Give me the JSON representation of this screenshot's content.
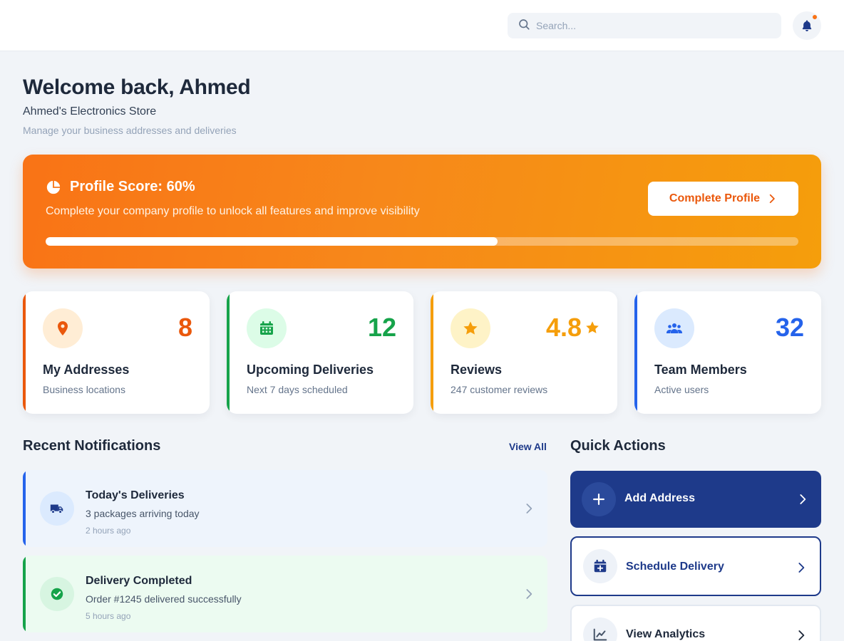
{
  "search": {
    "placeholder": "Search..."
  },
  "header": {
    "title": "Welcome back, Ahmed",
    "store_name": "Ahmed's Electronics Store",
    "subtitle": "Manage your business addresses and deliveries"
  },
  "profile_banner": {
    "title": "Profile Score: 60%",
    "description": "Complete your company profile to unlock all features and improve visibility",
    "progress_percent": 60,
    "button_label": "Complete Profile"
  },
  "stats": [
    {
      "label": "My Addresses",
      "value": "8",
      "sub": "Business locations",
      "color": "#ea580c",
      "icon": "map-pin-icon"
    },
    {
      "label": "Upcoming Deliveries",
      "value": "12",
      "sub": "Next 7 days scheduled",
      "color": "#16a34a",
      "icon": "calendar-icon"
    },
    {
      "label": "Reviews",
      "value": "4.8",
      "sub": "247 customer reviews",
      "color": "#f59e0b",
      "icon": "star-icon"
    },
    {
      "label": "Team Members",
      "value": "32",
      "sub": "Active users",
      "color": "#2563eb",
      "icon": "users-icon"
    }
  ],
  "notifications": {
    "title": "Recent Notifications",
    "view_all": "View All",
    "items": [
      {
        "title": "Today's Deliveries",
        "description": "3 packages arriving today",
        "time": "2 hours ago",
        "accent": "#2563eb",
        "icon": "truck-icon"
      },
      {
        "title": "Delivery Completed",
        "description": "Order #1245 delivered successfully",
        "time": "5 hours ago",
        "accent": "#16a34a",
        "icon": "check-circle-icon"
      }
    ]
  },
  "quick_actions": {
    "title": "Quick Actions",
    "items": [
      {
        "label": "Add Address",
        "icon": "plus-icon"
      },
      {
        "label": "Schedule Delivery",
        "icon": "calendar-plus-icon"
      },
      {
        "label": "View Analytics",
        "icon": "chart-line-icon"
      }
    ]
  },
  "colors": {
    "primary": "#1e3a8a",
    "accent_orange": "#f97316",
    "background": "#f1f4f8"
  }
}
